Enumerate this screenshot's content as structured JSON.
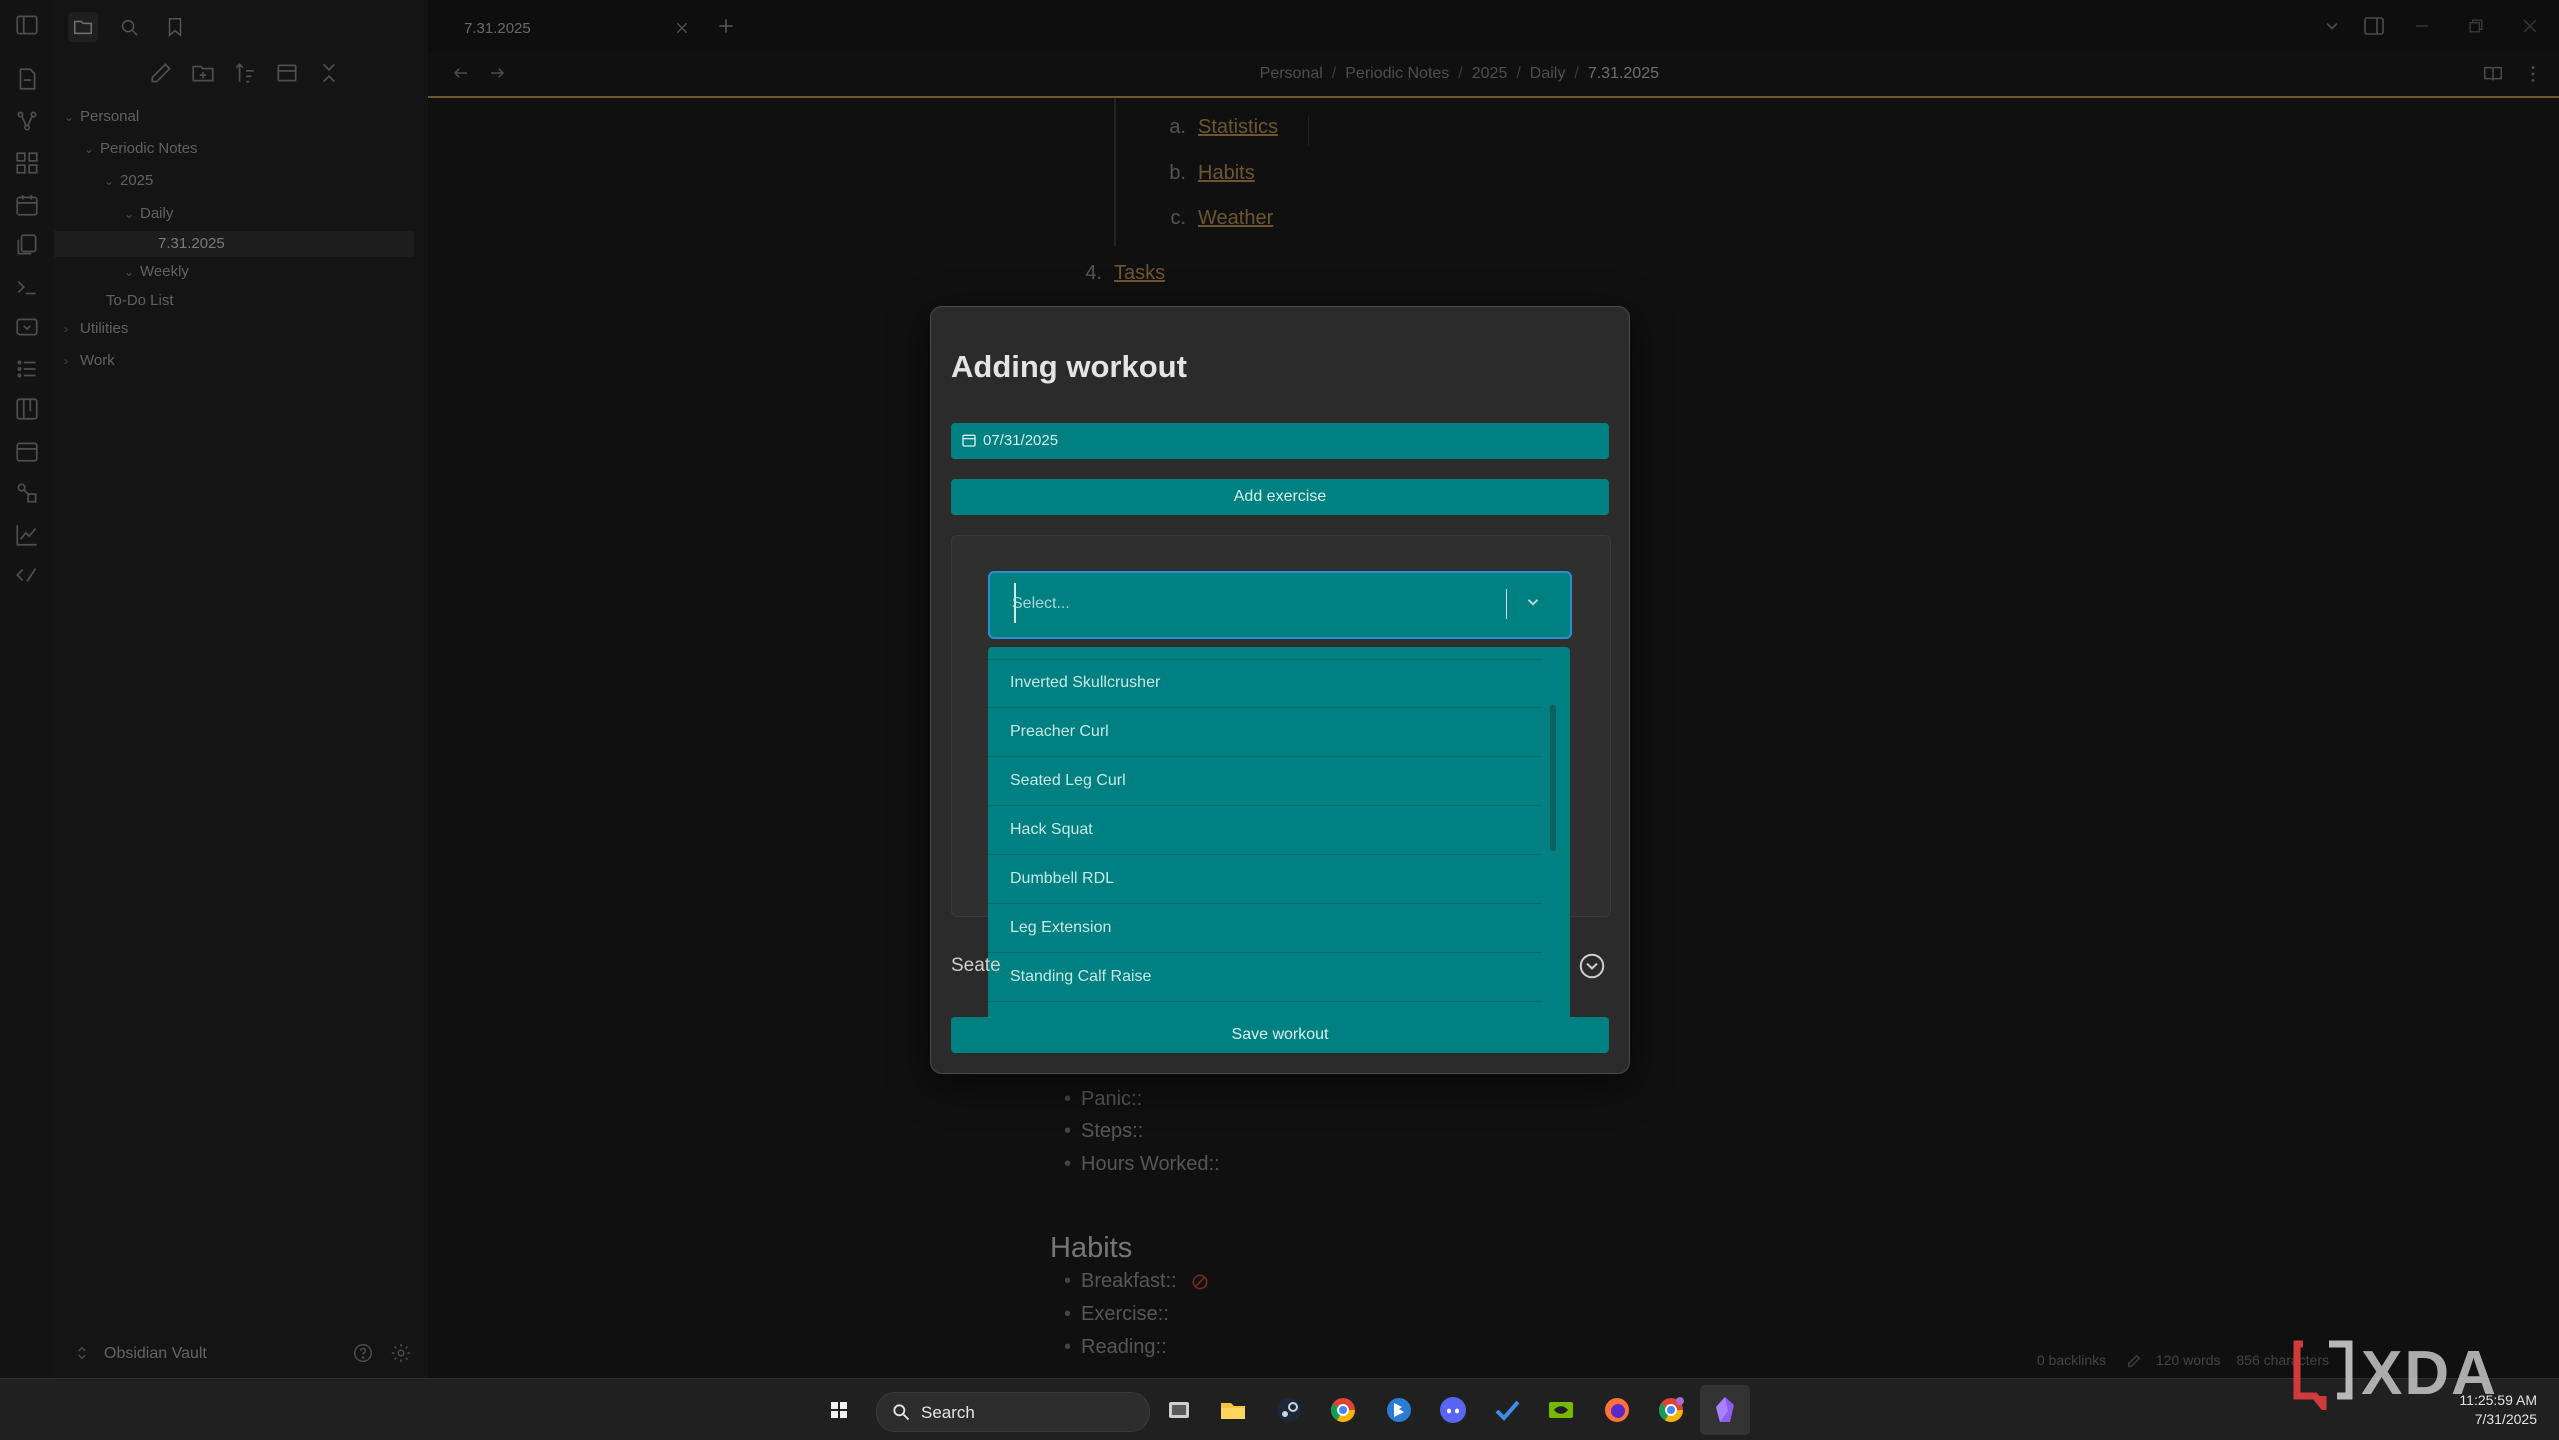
{
  "tab": {
    "title": "7.31.2025"
  },
  "breadcrumb": {
    "items": [
      "Personal",
      "Periodic Notes",
      "2025",
      "Daily"
    ],
    "current": "7.31.2025",
    "separator": "/"
  },
  "sidebar": {
    "tree": [
      {
        "label": "Personal",
        "chev": "⌄"
      },
      {
        "label": "Periodic Notes",
        "chev": "⌄"
      },
      {
        "label": "2025",
        "chev": "⌄"
      },
      {
        "label": "Daily",
        "chev": "⌄"
      },
      {
        "label": "7.31.2025"
      },
      {
        "label": "Weekly",
        "chev": "⌄"
      },
      {
        "label": "To-Do List"
      },
      {
        "label": "Utilities",
        "chev": "›"
      },
      {
        "label": "Work",
        "chev": "›"
      }
    ],
    "vault_name": "Obsidian Vault"
  },
  "editor": {
    "sub_list": [
      {
        "marker": "a.",
        "link": "Statistics"
      },
      {
        "marker": "b.",
        "link": "Habits"
      },
      {
        "marker": "c.",
        "link": "Weather"
      }
    ],
    "tasks_item": {
      "marker": "4.",
      "link": "Tasks"
    },
    "stats_bullets": [
      "Panic::",
      "Steps::",
      "Hours Worked::"
    ],
    "habits_heading": "Habits",
    "habits_bullets": [
      "Breakfast::",
      "Exercise::",
      "Reading::"
    ]
  },
  "modal": {
    "title": "Adding workout",
    "date_value": "07/31/2025",
    "add_exercise_label": "Add exercise",
    "select_placeholder": "Select...",
    "options": [
      "Inverted Skullcrusher",
      "Preacher Curl",
      "Seated Leg Curl",
      "Hack Squat",
      "Dumbbell RDL",
      "Leg Extension",
      "Standing Calf Raise"
    ],
    "section_label": "Seate",
    "save_label": "Save workout"
  },
  "status": {
    "backlinks": "0 backlinks",
    "words": "120 words",
    "characters": "856 characters"
  },
  "taskbar": {
    "search_label": "Search",
    "time": "11:25:59 AM",
    "date": "7/31/2025"
  },
  "watermark": {
    "text": "XDA"
  },
  "colors": {
    "accent": "#c99b57",
    "teal": "#008080",
    "focus": "#2a8fd6"
  }
}
